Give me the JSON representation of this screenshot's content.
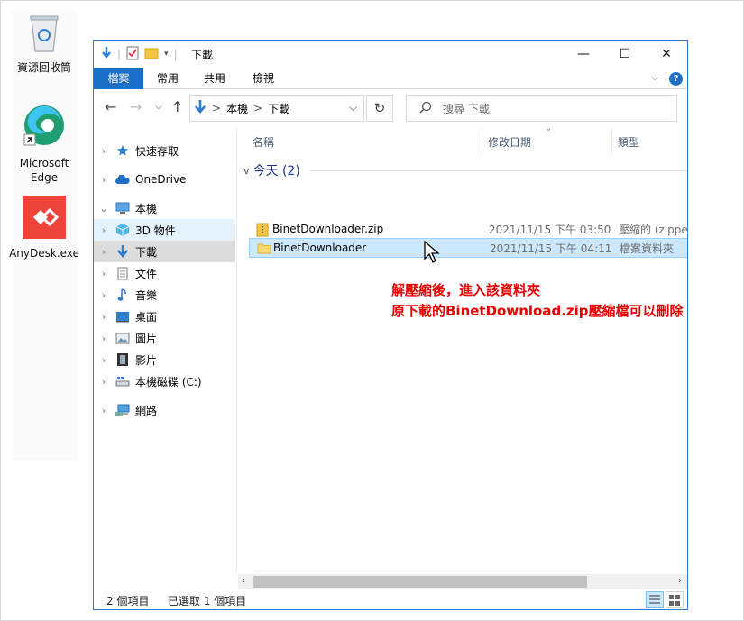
{
  "desktop": {
    "icons": [
      {
        "label": "資源回收筒",
        "icon": "recycle-bin-icon"
      },
      {
        "label": "Microsoft Edge",
        "icon": "edge-icon"
      },
      {
        "label": "AnyDesk.exe",
        "icon": "anydesk-icon"
      }
    ]
  },
  "window": {
    "title": "下載",
    "controls": {
      "minimize": "—",
      "maximize": "☐",
      "close": "✕"
    },
    "ribbon_tabs": [
      "檔案",
      "常用",
      "共用",
      "檢視"
    ],
    "ribbon_help": "?",
    "address": {
      "segments": [
        "本機",
        "下載"
      ],
      "separator": ">"
    },
    "search_placeholder": "搜尋 下載",
    "colors": {
      "accent": "#1a6fc9",
      "selection": "#cce8ff",
      "annotation": "#e60000"
    }
  },
  "sidebar": {
    "items": [
      {
        "label": "快速存取",
        "icon": "star-icon",
        "expand": ">"
      },
      {
        "label": "OneDrive",
        "icon": "cloud-icon",
        "expand": ">"
      },
      {
        "label": "本機",
        "icon": "pc-icon",
        "expand": "v"
      },
      {
        "label": "3D 物件",
        "icon": "cube-3d-icon",
        "expand": ">"
      },
      {
        "label": "下載",
        "icon": "download-arrow-icon",
        "expand": ">"
      },
      {
        "label": "文件",
        "icon": "document-icon",
        "expand": ">"
      },
      {
        "label": "音樂",
        "icon": "music-note-icon",
        "expand": ">"
      },
      {
        "label": "桌面",
        "icon": "desktop-icon",
        "expand": ">"
      },
      {
        "label": "圖片",
        "icon": "picture-icon",
        "expand": ">"
      },
      {
        "label": "影片",
        "icon": "film-icon",
        "expand": ">"
      },
      {
        "label": "本機磁碟 (C:)",
        "icon": "drive-icon",
        "expand": ">"
      },
      {
        "label": "網路",
        "icon": "network-icon",
        "expand": ">"
      }
    ]
  },
  "columns": {
    "name": "名稱",
    "date": "修改日期",
    "type": "類型"
  },
  "group": {
    "label": "今天 (2)",
    "chevron": "v"
  },
  "files": [
    {
      "name": "BinetDownloader.zip",
      "date": "2021/11/15 下午 03:50",
      "type": "壓縮的 (zipped",
      "icon": "zip-folder-icon"
    },
    {
      "name": "BinetDownloader",
      "date": "2021/11/15 下午 04:11",
      "type": "檔案資料夾",
      "icon": "folder-icon"
    }
  ],
  "annotation": {
    "line1": "解壓縮後，進入該資料夾",
    "line2": "原下載的BinetDownload.zip壓縮檔可以刪除"
  },
  "status": {
    "item_count": "2 個項目",
    "selected": "已選取 1 個項目"
  }
}
